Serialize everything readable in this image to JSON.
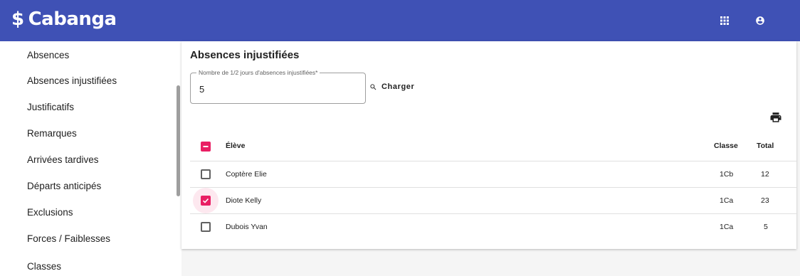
{
  "app": {
    "logo_text": "Cabanga",
    "logo_symbol": "$"
  },
  "colors": {
    "header": "#3f51b5",
    "accent": "#e91e63"
  },
  "topbar": {
    "icons": [
      "apps-icon",
      "account-circle-icon"
    ]
  },
  "sidebar": {
    "items": [
      {
        "label": "Absences"
      },
      {
        "label": "Absences injustifiées"
      },
      {
        "label": "Justificatifs"
      },
      {
        "label": "Remarques"
      },
      {
        "label": "Arrivées tardives"
      },
      {
        "label": "Départs anticipés"
      },
      {
        "label": "Exclusions"
      },
      {
        "label": "Forces / Faiblesses"
      },
      {
        "label": "Classes"
      }
    ]
  },
  "main": {
    "title": "Absences injustifiées",
    "field": {
      "label": "Nombre de 1/2 jours d'absences injustifiées*",
      "value": "5"
    },
    "load_button": "Charger",
    "table": {
      "headers": {
        "student": "Élève",
        "class": "Classe",
        "total": "Total"
      },
      "select_all_state": "indeterminate",
      "rows": [
        {
          "student": "Coptère Elie",
          "class": "1Cb",
          "total": "12",
          "checked": false
        },
        {
          "student": "Diote Kelly",
          "class": "1Ca",
          "total": "23",
          "checked": true
        },
        {
          "student": "Dubois Yvan",
          "class": "1Ca",
          "total": "5",
          "checked": false
        }
      ]
    }
  }
}
